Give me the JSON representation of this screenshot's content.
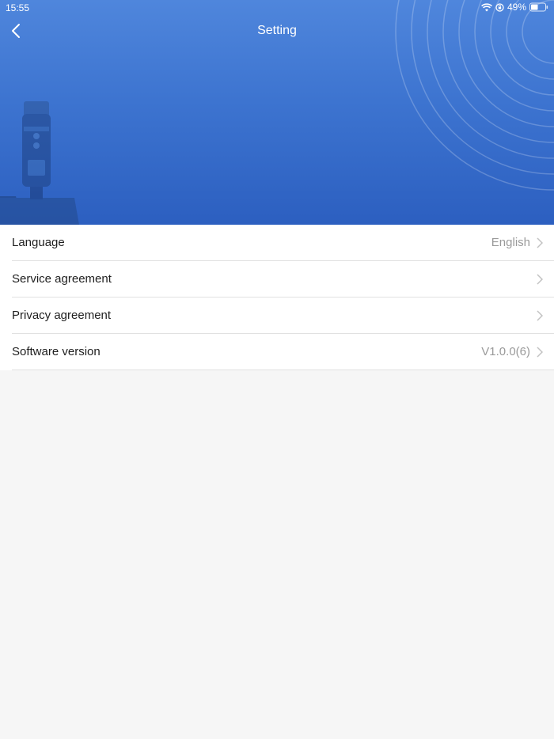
{
  "status_bar": {
    "time": "15:55",
    "battery": "49%",
    "icons": [
      "wifi-icon",
      "orientation-lock-icon",
      "battery-icon"
    ]
  },
  "header": {
    "title": "Setting",
    "back_icon": "back-chevron-icon"
  },
  "settings": [
    {
      "label": "Language",
      "value": "English"
    },
    {
      "label": "Service agreement",
      "value": ""
    },
    {
      "label": "Privacy agreement",
      "value": ""
    },
    {
      "label": "Software version",
      "value": "V1.0.0(6)"
    }
  ],
  "colors": {
    "header_top": "#4f86dc",
    "header_bottom": "#2c5fc0",
    "background": "#f6f6f6",
    "divider": "#e1e1e1"
  }
}
